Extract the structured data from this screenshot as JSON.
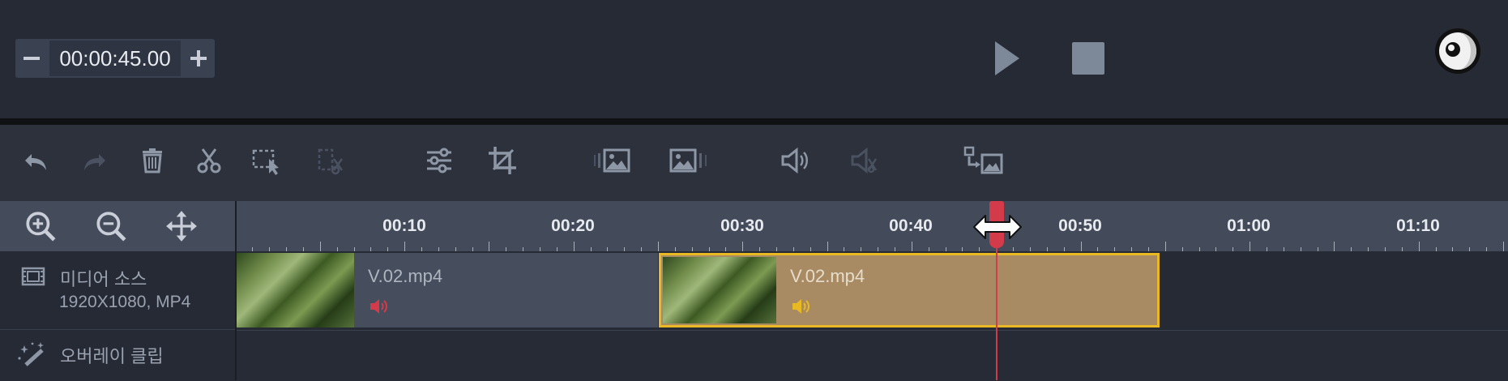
{
  "timecode": {
    "value": "00:00:45.00",
    "minus": "−",
    "plus": "+"
  },
  "toolbar_icons": [
    "undo-icon",
    "redo-icon",
    "delete-icon",
    "cut-icon",
    "select-icon",
    "split-icon",
    "adjust-icon",
    "crop-icon",
    "fade-in-icon",
    "fade-out-icon",
    "volume-icon",
    "mute-icon",
    "replace-icon"
  ],
  "zoom_icons": [
    "zoom-in-icon",
    "zoom-out-icon",
    "fit-icon"
  ],
  "ruler": {
    "labels": [
      "00:10",
      "00:20",
      "00:30",
      "00:40",
      "00:50",
      "01:00",
      "01:10"
    ]
  },
  "tracks": {
    "media": {
      "title": "미디어 소스",
      "subtitle": "1920X1080, MP4"
    },
    "overlay": {
      "title": "오버레이 클립"
    }
  },
  "clips": [
    {
      "name": "V.02.mp4",
      "selected": false
    },
    {
      "name": "V.02.mp4",
      "selected": true
    }
  ],
  "colors": {
    "accent": "#e8b923",
    "playhead": "#d33a4a",
    "selected_clip": "#a98b63",
    "clip": "#464e5d"
  }
}
